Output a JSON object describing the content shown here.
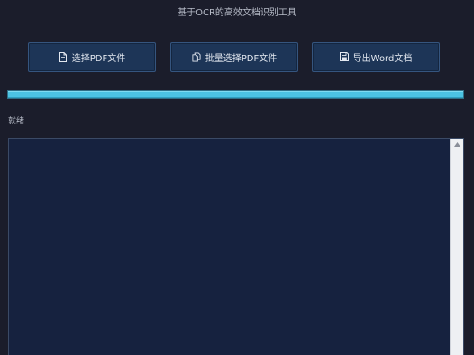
{
  "app": {
    "title": "基于OCR的高效文档识别工具"
  },
  "toolbar": {
    "select_pdf": {
      "label": "选择PDF文件",
      "icon": "file-icon"
    },
    "batch_select_pdf": {
      "label": "批量选择PDF文件",
      "icon": "files-icon"
    },
    "export_word": {
      "label": "导出Word文档",
      "icon": "save-icon"
    }
  },
  "progress": {
    "value_percent": 100,
    "color": "#4cc3e3"
  },
  "status": {
    "text": "就绪"
  },
  "log": {
    "content": ""
  },
  "colors": {
    "background": "#1b1d2b",
    "button": "#1d3557",
    "log_background": "#16223f",
    "accent": "#4cc3e3"
  }
}
